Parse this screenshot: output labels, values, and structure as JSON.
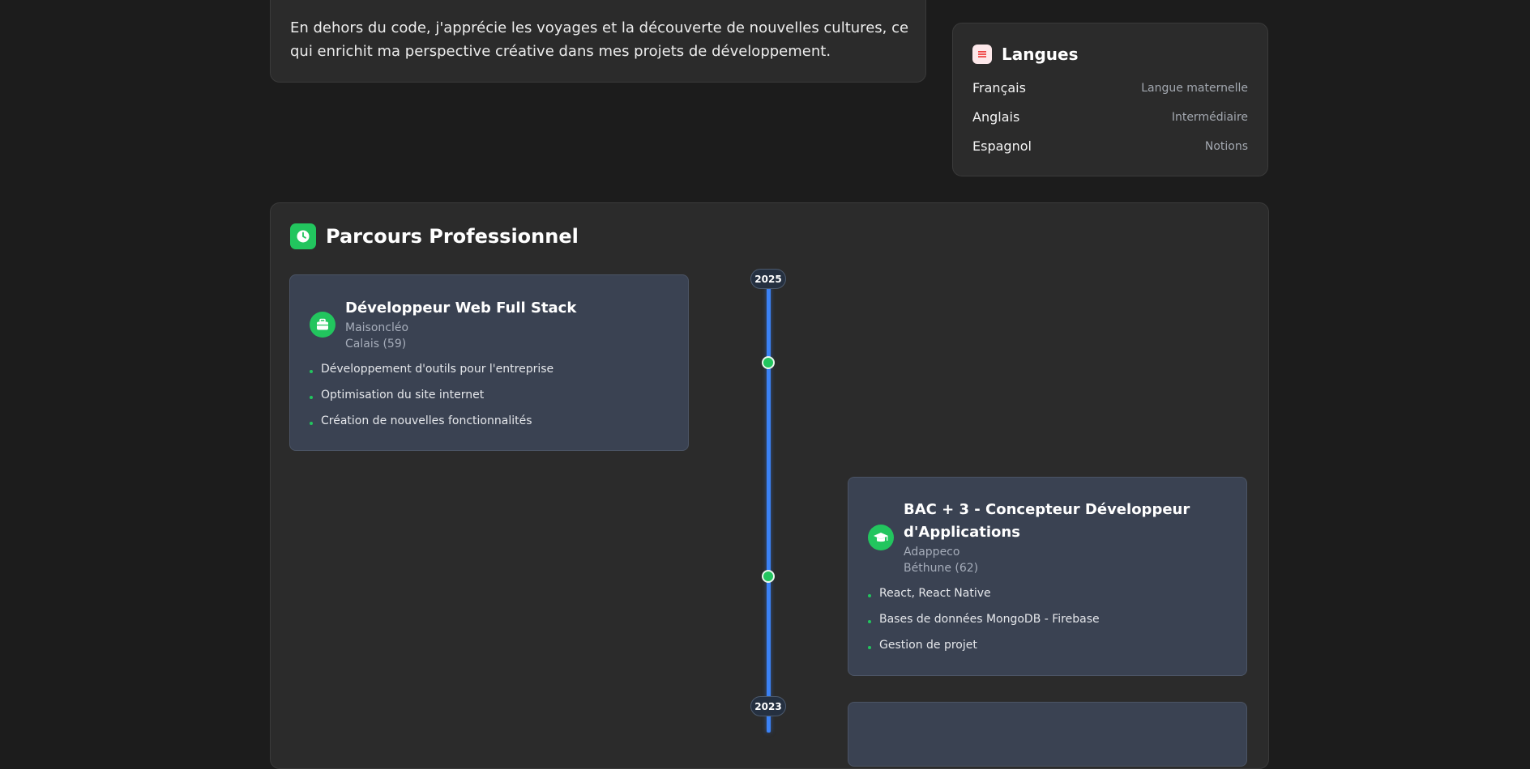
{
  "about": {
    "text": "En dehors du code, j'apprécie les voyages et la découverte de nouvelles cultures, ce qui enrichit ma perspective créative dans mes projets de développement."
  },
  "languages": {
    "title": "Langues",
    "icon": "list-icon",
    "items": [
      {
        "name": "Français",
        "level": "Langue maternelle"
      },
      {
        "name": "Anglais",
        "level": "Intermédiaire"
      },
      {
        "name": "Espagnol",
        "level": "Notions"
      }
    ]
  },
  "timeline": {
    "title": "Parcours Professionnel",
    "icon": "clock-icon",
    "years": [
      "2025",
      "2023"
    ],
    "entries": [
      {
        "title": "Développeur Web Full Stack",
        "company": "Maisoncléo",
        "location": "Calais (59)",
        "icon": "briefcase-icon",
        "items": [
          "Développement d'outils pour l'entreprise",
          "Optimisation du site internet",
          "Création de nouvelles fonctionnalités"
        ]
      },
      {
        "title": "BAC + 3 - Concepteur Développeur d'Applications",
        "company": "Adappeco",
        "location": "Béthune (62)",
        "icon": "graduation-cap-icon",
        "items": [
          "React, React Native",
          "Bases de données MongoDB - Firebase",
          "Gestion de projet"
        ]
      }
    ]
  },
  "colors": {
    "accent_green": "#22c55e",
    "timeline_blue": "#3b82f6",
    "card_bg": "#2b2b2b",
    "entry_bg": "#3a4252"
  }
}
